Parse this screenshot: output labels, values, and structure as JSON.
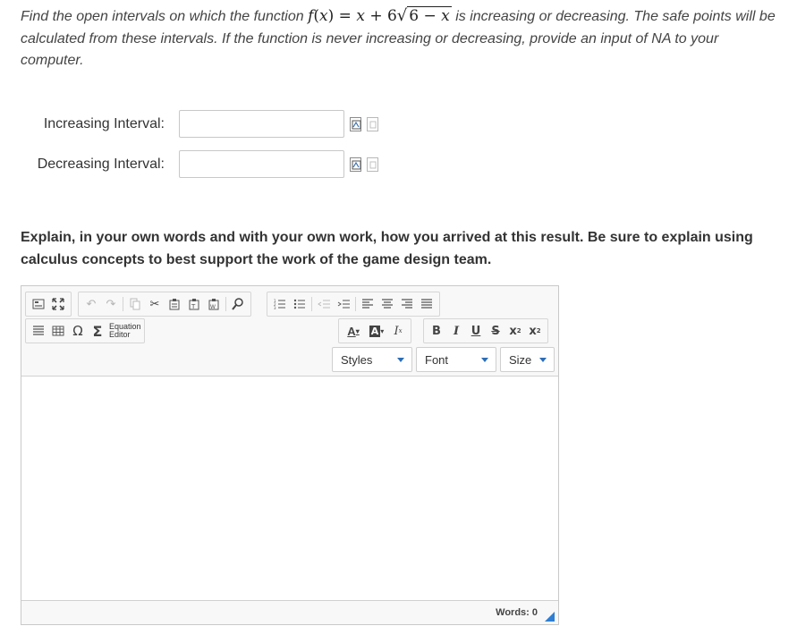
{
  "question": {
    "prefix": "Find the open intervals on which the function ",
    "suffix": " is increasing or decreasing. The safe points will be calculated from these intervals. If the function is never increasing or decreasing, provide an input of NA to your computer."
  },
  "fields": [
    {
      "label": "Increasing Interval:",
      "value": "",
      "placeholder": ""
    },
    {
      "label": "Decreasing Interval:",
      "value": "",
      "placeholder": ""
    }
  ],
  "explain_prompt": "Explain, in your own words and with your own work, how you arrived at this result. Be sure to explain using calculus concepts to best support the work of the game design team.",
  "editor": {
    "equation_label_1": "Equation",
    "equation_label_2": "Editor",
    "format_a": "A",
    "bold": "B",
    "italic": "I",
    "underline": "U",
    "strike": "S",
    "subscript": "x",
    "superscript": "x",
    "styles": "Styles",
    "font": "Font",
    "size": "Size",
    "words": "Words: 0",
    "accent_color": "#2e7ed4"
  }
}
